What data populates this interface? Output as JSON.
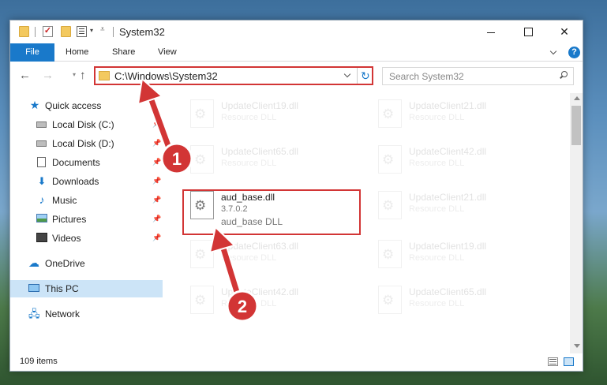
{
  "window": {
    "title": "System32",
    "close_glyph": "✕"
  },
  "ribbon": {
    "tabs": [
      "File",
      "Home",
      "Share",
      "View"
    ],
    "help_glyph": "?"
  },
  "nav": {
    "back_glyph": "←",
    "forward_glyph": "→",
    "caret_glyph": "▾",
    "up_glyph": "↑",
    "address_value": "C:\\Windows\\System32",
    "refresh_glyph": "↻",
    "search_placeholder": "Search System32"
  },
  "sidebar": {
    "items": [
      {
        "label": "Quick access",
        "icon": "quick-access-star-icon",
        "pinned": false
      },
      {
        "label": "Local Disk (C:)",
        "icon": "disk-c-icon",
        "pinned": true
      },
      {
        "label": "Local Disk (D:)",
        "icon": "disk-d-icon",
        "pinned": true
      },
      {
        "label": "Documents",
        "icon": "documents-icon",
        "pinned": true
      },
      {
        "label": "Downloads",
        "icon": "downloads-icon",
        "pinned": true
      },
      {
        "label": "Music",
        "icon": "music-icon",
        "pinned": true
      },
      {
        "label": "Pictures",
        "icon": "pictures-icon",
        "pinned": true
      },
      {
        "label": "Videos",
        "icon": "videos-icon",
        "pinned": true
      },
      {
        "label": "OneDrive",
        "icon": "onedrive-icon",
        "pinned": false
      },
      {
        "label": "This PC",
        "icon": "this-pc-icon",
        "pinned": false,
        "selected": true
      },
      {
        "label": "Network",
        "icon": "network-icon",
        "pinned": false
      }
    ],
    "pin_glyph": "📌"
  },
  "files": {
    "left_column": [
      {
        "name": "UpdateClient19.dll",
        "type": "Resource DLL"
      },
      {
        "name": "UpdateClient65.dll",
        "type": "Resource DLL"
      },
      {
        "name": "aud_base.dll",
        "version": "3.7.0.2",
        "type": "aud_base DLL",
        "highlighted": true
      },
      {
        "name": "UpdateClient63.dll",
        "type": "Resource DLL"
      },
      {
        "name": "UpdateClient42.dll",
        "type": "Resource DLL"
      }
    ],
    "right_column": [
      {
        "name": "UpdateClient21.dll",
        "type": "Resource DLL"
      },
      {
        "name": "UpdateClient42.dll",
        "type": "Resource DLL"
      },
      {
        "name": "UpdateClient21.dll",
        "type": "Resource DLL"
      },
      {
        "name": "UpdateClient19.dll",
        "type": "Resource DLL"
      },
      {
        "name": "UpdateClient65.dll",
        "type": "Resource DLL"
      }
    ]
  },
  "status": {
    "item_count": "109 items"
  },
  "annotations": {
    "step1": "1",
    "step2": "2",
    "color": "#d23535"
  },
  "colors": {
    "accent": "#1979ca",
    "selected": "#cce4f7",
    "highlight": "#d23535"
  }
}
